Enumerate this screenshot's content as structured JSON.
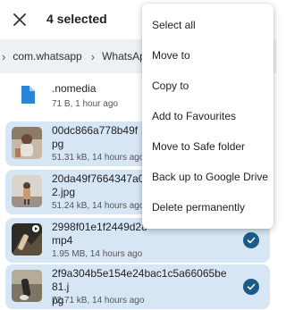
{
  "topbar": {
    "title": "4 selected"
  },
  "breadcrumb": {
    "items": [
      "com.whatsapp",
      "WhatsAp"
    ]
  },
  "files": [
    {
      "name": ".nomedia",
      "meta": "71 B, 1 hour ago",
      "selected": false,
      "type": "doc"
    },
    {
      "name": "00dc866a778b49fe6fd1b1b2f3c9b0.jpg",
      "name_display_1": "00dc866a778b49f",
      "name_display_2": "pg",
      "meta": "51.31 kB, 14 hours ago",
      "selected": true
    },
    {
      "name_display_1": "20da49f7664347a0",
      "name_display_2": "2.jpg",
      "meta": "51.24 kB, 14 hours ago",
      "selected": true
    },
    {
      "name_display_1": "2998f01e1f2449d28",
      "name_display_2": "mp4",
      "meta": "1.95 MB, 14 hours ago",
      "selected": true
    },
    {
      "name_display_1": "2f9a304b5e154e24bac1c5a66065be81.j",
      "name_display_2": "pg",
      "meta": "72.71 kB, 14 hours ago",
      "selected": true
    }
  ],
  "menu": {
    "items": [
      "Select all",
      "Move to",
      "Copy to",
      "Add to Favourites",
      "Move to Safe folder",
      "Back up to Google Drive",
      "Delete permanently"
    ]
  },
  "colors": {
    "accent": "#1b5b86",
    "selected_row": "#d7e6f4",
    "breadcrumb_bg": "#ecf1f5"
  }
}
